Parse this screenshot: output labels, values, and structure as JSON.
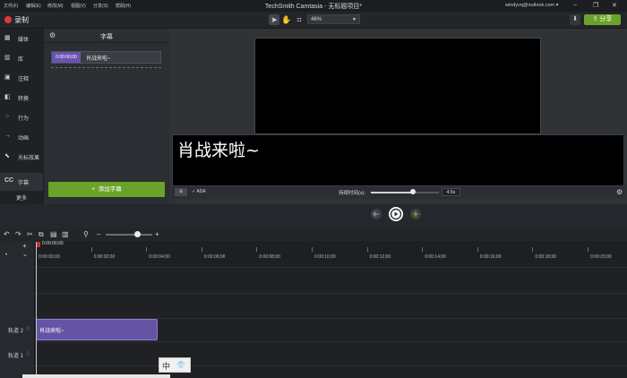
{
  "menubar": {
    "items": [
      "文件(F)",
      "编辑(E)",
      "修改(M)",
      "视图(V)",
      "分享(S)",
      "帮助(H)"
    ],
    "title": "TechSmith Camtasia - 无标题项目*",
    "account": "windyvq@outlook.com",
    "window_buttons": [
      "minimize-icon",
      "restore-icon",
      "close-icon"
    ]
  },
  "toolbar": {
    "record_label": "录制",
    "zoom": "46%",
    "share_label": "分享",
    "tools": [
      "select-arrow-icon",
      "hand-pan-icon",
      "crop-icon"
    ]
  },
  "nav": {
    "items": [
      {
        "icon": "media-icon",
        "label": "媒体"
      },
      {
        "icon": "library-icon",
        "label": "库"
      },
      {
        "icon": "annotations-icon",
        "label": "注释"
      },
      {
        "icon": "transitions-icon",
        "label": "转换"
      },
      {
        "icon": "behaviors-icon",
        "label": "行为"
      },
      {
        "icon": "animations-icon",
        "label": "动画"
      },
      {
        "icon": "cursor-effects-icon",
        "label": "光标效果"
      },
      {
        "icon": "captions-icon",
        "label": "字幕"
      }
    ],
    "more": "更多",
    "active_index": 7
  },
  "captions_panel": {
    "title": "字幕",
    "entry": {
      "time": "0:00:00;00",
      "text": "肖战来啦~"
    },
    "add_button": "添加字幕"
  },
  "caption_editor": {
    "text": "肖战来啦~",
    "font_button": "a",
    "ada": "ADA",
    "duration_label": "持续时间(s):",
    "duration_value": "4.5s",
    "duration_fraction": 0.62
  },
  "timeline": {
    "playhead_time": "0:00:00;00",
    "ruler": [
      "0:00:00;00",
      "0:00:02;00",
      "0:00:04;00",
      "0:00:06;00",
      "0:00:08;00",
      "0:00:10;00",
      "0:00:12;00",
      "0:00:14;00",
      "0:00:16;00",
      "0:00:18;00",
      "0:00:20;00"
    ],
    "tracks": [
      {
        "name": "轨道 2",
        "clip": "肖战来啦~"
      },
      {
        "name": "轨道 1",
        "clip": ""
      }
    ],
    "zoom_fraction": 0.65
  },
  "ime": {
    "label": "中"
  },
  "colors": {
    "accent_green": "#6aa329",
    "clip_purple": "#6553a6",
    "record_red": "#e03a3e"
  }
}
